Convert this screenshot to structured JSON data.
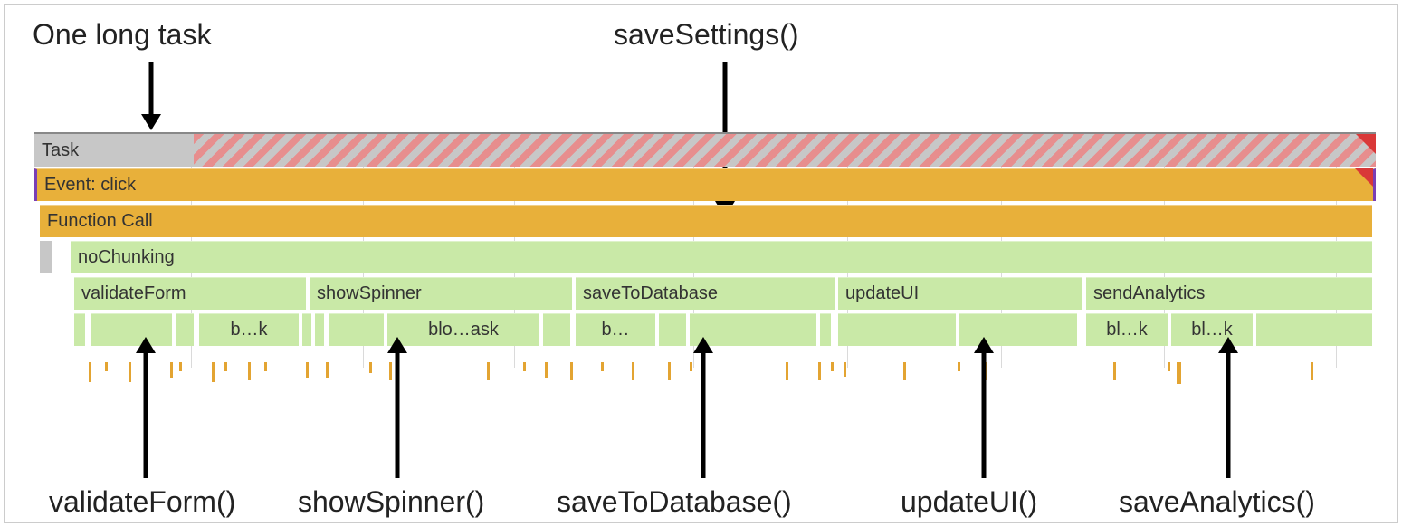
{
  "annotations": {
    "top_left": "One long task",
    "top_right": "saveSettings()",
    "bottom_1": "validateForm()",
    "bottom_2": "showSpinner()",
    "bottom_3": "saveToDatabase()",
    "bottom_4": "updateUI()",
    "bottom_5": "saveAnalytics()"
  },
  "bars": {
    "task_label": "Task",
    "event": "Event: click",
    "function_call": "Function Call",
    "no_chunking": "noChunking",
    "children": {
      "validateForm": "validateForm",
      "showSpinner": "showSpinner",
      "saveToDatabase": "saveToDatabase",
      "updateUI": "updateUI",
      "sendAnalytics": "sendAnalytics"
    },
    "micro": {
      "b1": "b…k",
      "b2": "blo…ask",
      "b3": "b…",
      "b4": "bl…k",
      "b5": "bl…k"
    }
  },
  "colors": {
    "gray": "#c7c7c7",
    "orange": "#e8b03a",
    "green": "#c9e9a7",
    "red": "#d93838",
    "purple": "#7a3fb5"
  }
}
